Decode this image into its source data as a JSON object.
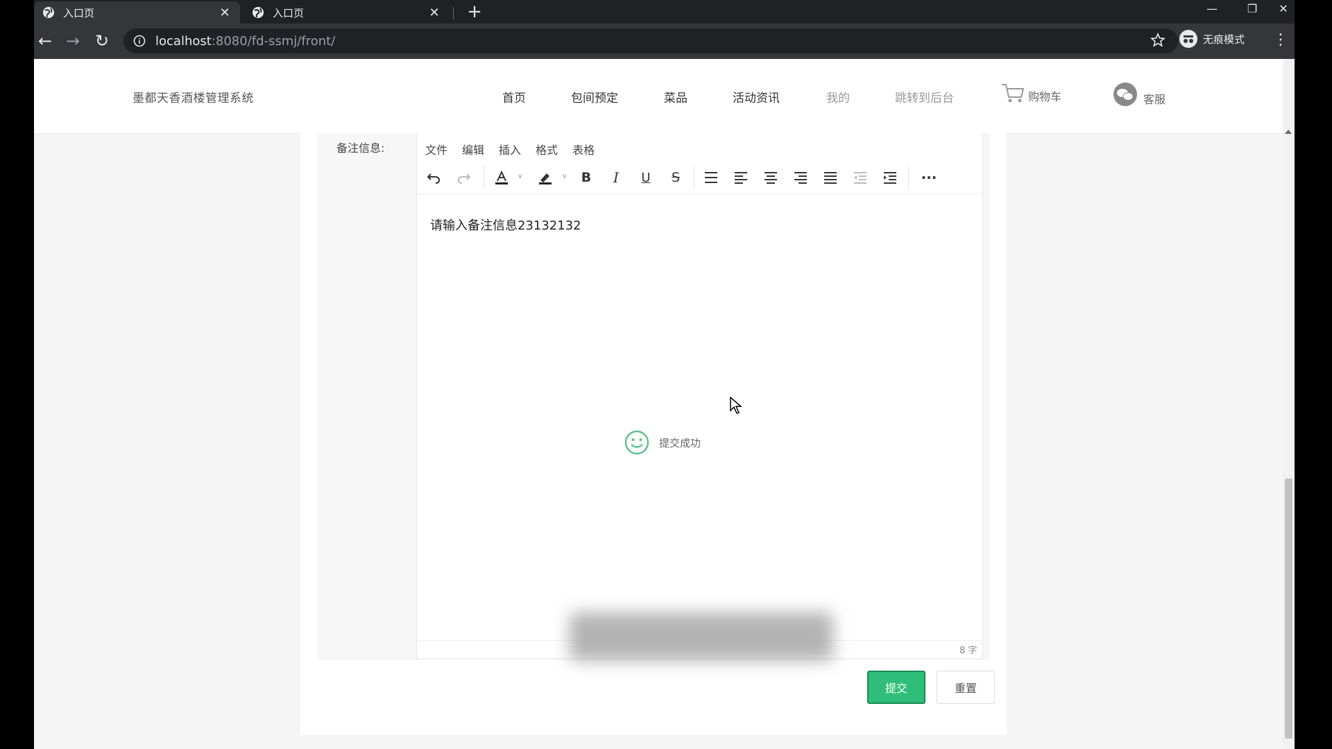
{
  "browser": {
    "tabs": [
      {
        "title": "入口页",
        "active": true
      },
      {
        "title": "入口页",
        "active": false
      }
    ],
    "url_host": "localhost",
    "url_rest": ":8080/fd-ssmj/front/",
    "profile_label": "无痕模式"
  },
  "site": {
    "title": "墨都天香酒楼管理系统",
    "nav": [
      "首页",
      "包间预定",
      "菜品",
      "活动资讯",
      "我的",
      "跳转到后台"
    ],
    "cart_label": "购物车",
    "service_label": "客服"
  },
  "form": {
    "field_label": "备注信息:",
    "editor_menus": [
      "文件",
      "编辑",
      "插入",
      "格式",
      "表格"
    ],
    "editor_content": "请输入备注信息23132132",
    "word_count": "8 字",
    "submit_label": "提交",
    "reset_label": "重置"
  },
  "toast": {
    "message": "提交成功"
  },
  "colors": {
    "primary_green": "#2fbe79",
    "tab_bar": "#202124",
    "toolbar": "#35363a"
  }
}
